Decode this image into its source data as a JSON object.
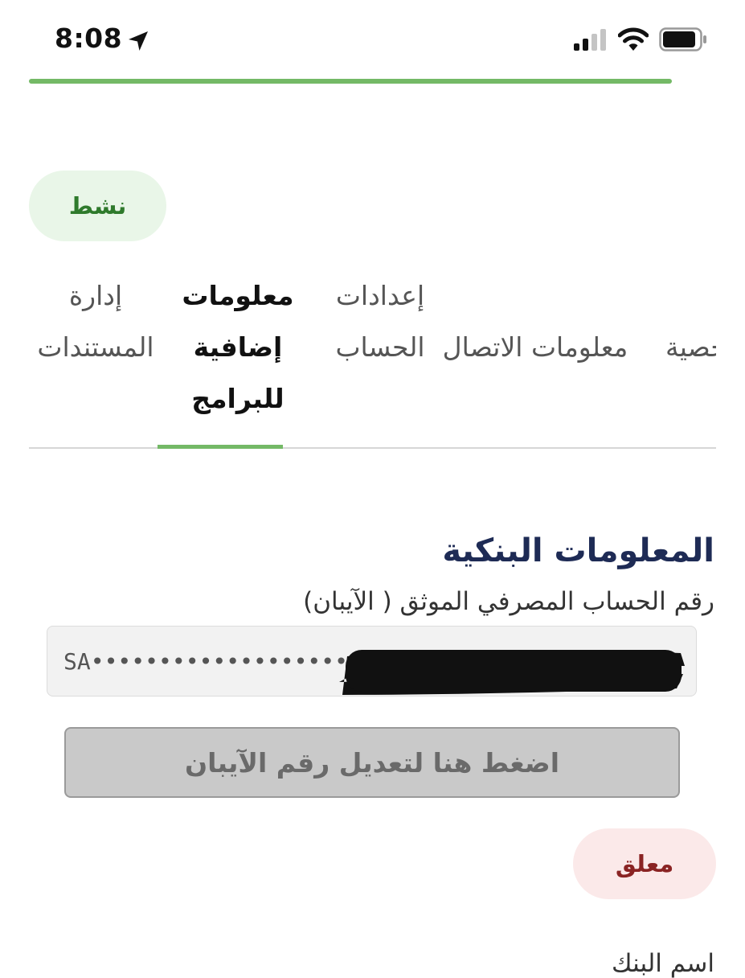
{
  "status_bar": {
    "time": "8:08"
  },
  "badges": {
    "active": "نشط",
    "pending": "معلق"
  },
  "tabs": [
    {
      "line1": "إدارة",
      "line2": "المستندات",
      "line3": ""
    },
    {
      "line1": "معلومات",
      "line2": "إضافية",
      "line3": "للبرامج"
    },
    {
      "line1": "إعدادات",
      "line2": "الحساب",
      "line3": ""
    },
    {
      "line1": "",
      "line2": "معلومات الاتصال",
      "line3": ""
    },
    {
      "line1": "",
      "line2": "المعلومات الشخصية",
      "line3": ""
    }
  ],
  "bank": {
    "title": "المعلومات البنكية",
    "iban_label": "رقم الحساب المصرفي الموثق ( الآيبان)",
    "iban_value": "SA••••••••••••••••••••",
    "edit_button": "اضغط هنا لتعديل رقم الآيبان"
  },
  "next_field_label": "اسم البنك",
  "colors": {
    "accent_green": "#74b966",
    "active_badge_bg": "#e9f6e8",
    "active_badge_text": "#2f7a2c",
    "pending_badge_bg": "#fbe9e9",
    "pending_badge_text": "#8a2323",
    "title_navy": "#1e2b55"
  }
}
